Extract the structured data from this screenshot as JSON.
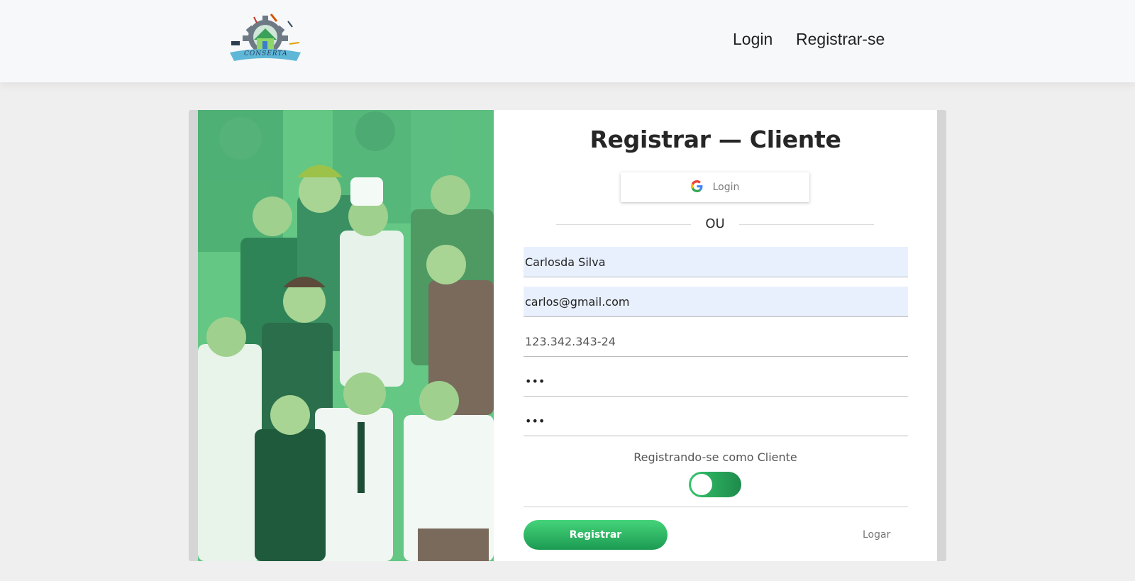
{
  "header": {
    "logo_text": "CONSERTA",
    "nav": {
      "login": "Login",
      "register": "Registrar-se"
    }
  },
  "form": {
    "title": "Registrar — Cliente",
    "google_label": "Login",
    "or_text": "OU",
    "name_value": "Carlosda Silva",
    "email_value": "carlos@gmail.com",
    "cpf_value": "123.342.343-24",
    "password_value": "123",
    "confirm_password_value": "123",
    "role_label": "Registrando-se como Cliente",
    "submit_label": "Registrar",
    "login_link": "Logar"
  },
  "colors": {
    "accent": "#2db863",
    "hero_green": "#5fc47f",
    "autofill_bg": "#e8f0fe"
  },
  "icons": [
    "google-icon",
    "conserta-logo"
  ]
}
